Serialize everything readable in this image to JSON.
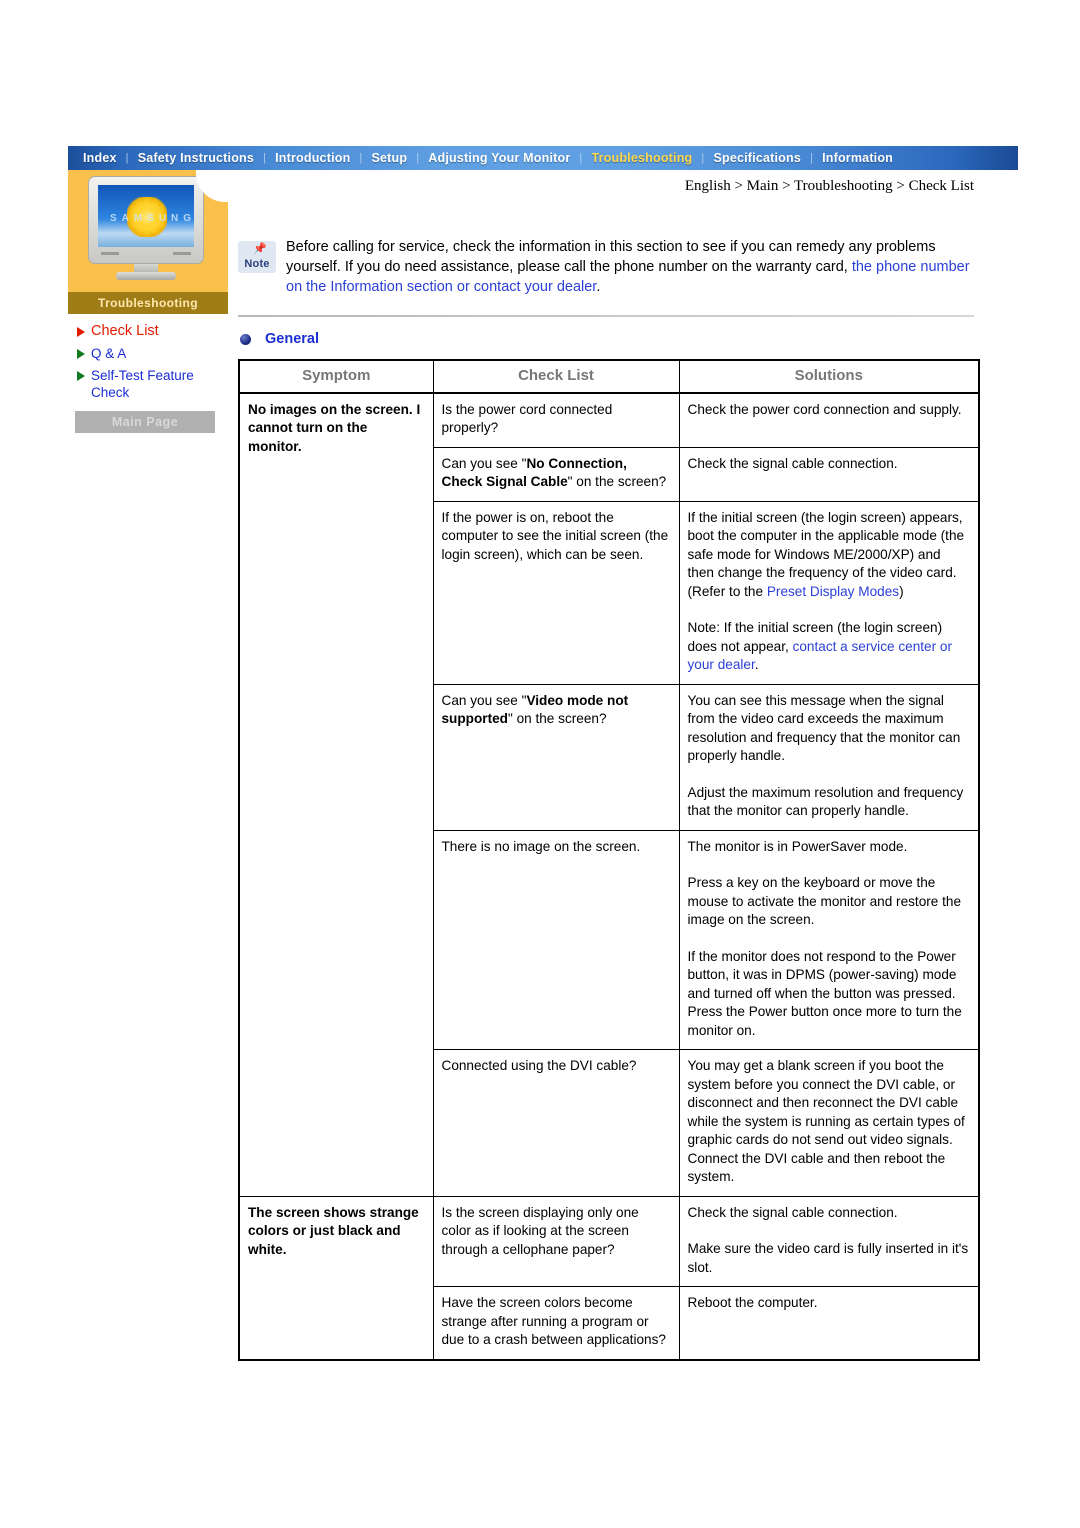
{
  "navbar": {
    "items": [
      {
        "label": "Index",
        "active": false
      },
      {
        "label": "Safety Instructions",
        "active": false
      },
      {
        "label": "Introduction",
        "active": false
      },
      {
        "label": "Setup",
        "active": false
      },
      {
        "label": "Adjusting Your Monitor",
        "active": false
      },
      {
        "label": "Troubleshooting",
        "active": true
      },
      {
        "label": "Specifications",
        "active": false
      },
      {
        "label": "Information",
        "active": false
      }
    ],
    "separator": "|",
    "active_color": "#ffd84d",
    "bar_color": "#2c69bd"
  },
  "sidebar": {
    "panel_caption": "Troubleshooting",
    "monitor_brand_text": "SAMSUNG",
    "links": [
      {
        "label": "Check List",
        "active": true,
        "bullet_color": "#e01b00",
        "text_color": "#e01b00"
      },
      {
        "label": "Q & A",
        "active": false,
        "bullet_color": "#127a1e",
        "text_color": "#1c2ed6"
      },
      {
        "label": "Self-Test Feature Check",
        "active": false,
        "bullet_color": "#127a1e",
        "text_color": "#1c2ed6"
      }
    ],
    "main_page_button": "Main Page"
  },
  "content": {
    "breadcrumb": "English > Main > Troubleshooting > Check List",
    "note": {
      "icon_label": "Note",
      "text_plain": "Before calling for service, check the information in this section to see if you can remedy any problems yourself. If you do need assistance, please call the phone number on the warranty card, ",
      "text_link": "the phone number on the Information section or contact your dealer",
      "text_tail": "."
    },
    "section_heading": "General"
  },
  "table": {
    "headers": [
      "Symptom",
      "Check List",
      "Solutions"
    ],
    "rows": [
      {
        "symptom": "No images on the screen. I cannot turn on the monitor.",
        "symptom_rowspan": 5,
        "check": "Is the power cord connected properly?",
        "solution": "Check the power cord connection and supply."
      },
      {
        "check_pre": "Can you see \"",
        "check_bold": "No Connection, Check Signal Cable",
        "check_post": "\" on the screen?",
        "solution": "Check the signal cable connection."
      },
      {
        "check": "If the power is on, reboot the computer to see the initial screen (the login screen), which can be seen.",
        "solution_p1": "If the initial screen (the login screen) appears, boot the computer in the applicable mode (the safe mode for Windows ME/2000/XP) and then change the frequency of the video card.",
        "solution_p2_pre": "(Refer to the ",
        "solution_p2_link": "Preset Display Modes",
        "solution_p2_post": ")",
        "solution_p3_pre": "Note: If the initial screen (the login screen) does not appear, ",
        "solution_p3_link": "contact a service center or your dealer",
        "solution_p3_post": "."
      },
      {
        "check_pre": "Can you see \"",
        "check_bold": "Video mode not supported",
        "check_post": "\" on the screen?",
        "solution_p1": "You can see this message when the signal from the video card exceeds the maximum resolution and frequency that the monitor can properly handle.",
        "solution_p2": "Adjust the maximum resolution and frequency that the monitor can properly handle."
      },
      {
        "check": "There is no image on the screen.",
        "solution_p1": "The monitor is in PowerSaver mode.",
        "solution_p2": "Press a key on the keyboard or move the mouse to activate the monitor and restore the image on the screen.",
        "solution_p3": "If the monitor does not respond to the Power button, it was in DPMS (power-saving) mode and turned off when the button was pressed. Press the Power button once more to turn the monitor on."
      },
      {
        "check": "Connected using the DVI cable?",
        "solution": "You may get a blank screen if you boot the system before you connect the DVI cable, or disconnect and then reconnect the DVI cable while the system is running as certain types of graphic cards do not send out video signals. Connect the DVI cable and then reboot the system."
      },
      {
        "symptom": "The screen shows strange colors or just black and white.",
        "symptom_rowspan": 2,
        "check": "Is the screen displaying only one color as if looking at the screen through a cellophane paper?",
        "solution_p1": "Check the signal cable connection.",
        "solution_p2": "Make sure the video card is fully inserted in it's slot."
      },
      {
        "check": "Have the screen colors become strange after running a program or due to a crash between applications?",
        "solution": "Reboot the computer."
      }
    ]
  }
}
